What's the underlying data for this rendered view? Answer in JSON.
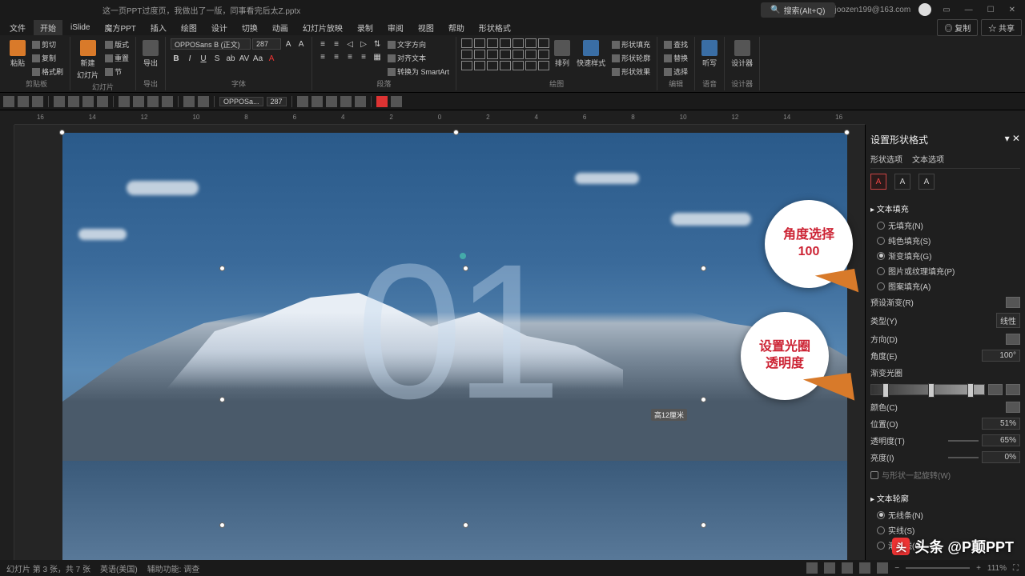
{
  "title": "这一页PPT过度页，我做出了一版，同事看完后太Z.pptx",
  "search_placeholder": "搜索(Alt+Q)",
  "user_email": "joozen199@163.com",
  "titlebar_buttons": {
    "copy": "◎ 复制",
    "share": "☆ 共享"
  },
  "menu": [
    "文件",
    "开始",
    "iSlide",
    "魔方PPT",
    "插入",
    "绘图",
    "设计",
    "切换",
    "动画",
    "幻灯片放映",
    "录制",
    "审阅",
    "视图",
    "帮助",
    "形状格式"
  ],
  "menu_active_index": 1,
  "ribbon": {
    "clipboard": {
      "paste": "粘贴",
      "cut": "剪切",
      "copy": "复制",
      "format": "格式刷",
      "label": "剪贴板"
    },
    "slides": {
      "new": "新建",
      "layout": "幻灯片",
      "items": [
        "版式",
        "重置",
        "节"
      ],
      "label": "幻灯片"
    },
    "reuse": {
      "btn": "导出",
      "label": "导出"
    },
    "font": {
      "family": "OPPOSans B (正文)",
      "size": "287",
      "label": "字体"
    },
    "paragraph": {
      "label": "段落",
      "dir": "文字方向",
      "align": "对齐文本",
      "smartart": "转换为 SmartArt"
    },
    "drawing": {
      "arrange": "排列",
      "quick": "快速样式",
      "fill": "形状填充",
      "outline": "形状轮廓",
      "effects": "形状效果",
      "label": "绘图"
    },
    "editing": {
      "find": "查找",
      "replace": "替换",
      "select": "选择",
      "label": "编辑"
    },
    "voice": {
      "btn": "听写",
      "label": "语音"
    },
    "designer": {
      "btn": "设计器",
      "label": "设计器"
    }
  },
  "quick_toolbar": {
    "font": "OPPOSa...",
    "size": "287"
  },
  "ruler_h": [
    "16",
    "14",
    "12",
    "10",
    "8",
    "6",
    "4",
    "2",
    "0",
    "2",
    "4",
    "6",
    "8",
    "10",
    "12",
    "14",
    "16"
  ],
  "slide": {
    "big_number": "01",
    "size_tip": "高12厘米"
  },
  "callouts": {
    "c1_line1": "角度选择",
    "c1_line2": "100",
    "c2_line1": "设置光圈",
    "c2_line2": "透明度"
  },
  "panel": {
    "title": "设置形状格式",
    "tabs": [
      "形状选项",
      "文本选项"
    ],
    "section_fill": "▸ 文本填充",
    "fill_options": [
      "无填充(N)",
      "纯色填充(S)",
      "渐变填充(G)",
      "图片或纹理填充(P)",
      "图案填充(A)"
    ],
    "fill_checked_index": 2,
    "preset_label": "预设渐变(R)",
    "type_label": "类型(Y)",
    "type_value": "线性",
    "direction_label": "方向(D)",
    "angle_label": "角度(E)",
    "angle_value": "100°",
    "stops_label": "渐变光圈",
    "color_label": "颜色(C)",
    "position_label": "位置(O)",
    "position_value": "51%",
    "transparency_label": "透明度(T)",
    "transparency_value": "65%",
    "brightness_label": "亮度(I)",
    "brightness_value": "0%",
    "rotate_with_shape": "与形状一起旋转(W)",
    "section_outline": "▸ 文本轮廓",
    "outline_options": [
      "无线条(N)",
      "实线(S)",
      "渐变线(G)"
    ],
    "outline_checked_index": 0
  },
  "statusbar": {
    "slide_info": "幻灯片 第 3 张，共 7 张",
    "lang": "英语(美国)",
    "access": "辅助功能: 调查",
    "zoom": "111%"
  },
  "watermark": "头条 @P颠PPT"
}
